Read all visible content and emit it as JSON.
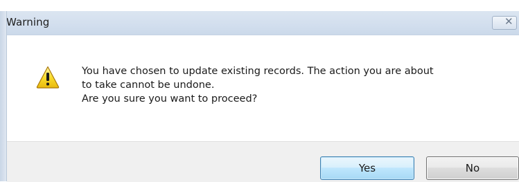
{
  "dialog": {
    "title": "Warning",
    "close_icon": "close-icon",
    "message_lines": [
      "You have chosen to update existing records.  The action you are about",
      "to take cannot be undone.",
      "Are you sure you want to proceed?"
    ],
    "icon": "warning-icon",
    "buttons": {
      "yes": "Yes",
      "no": "No"
    },
    "colors": {
      "title_bar": "#d3dfee",
      "footer": "#f0f0f0",
      "default_button_border": "#3c7fb1",
      "warning_yellow": "#f5d312"
    }
  }
}
